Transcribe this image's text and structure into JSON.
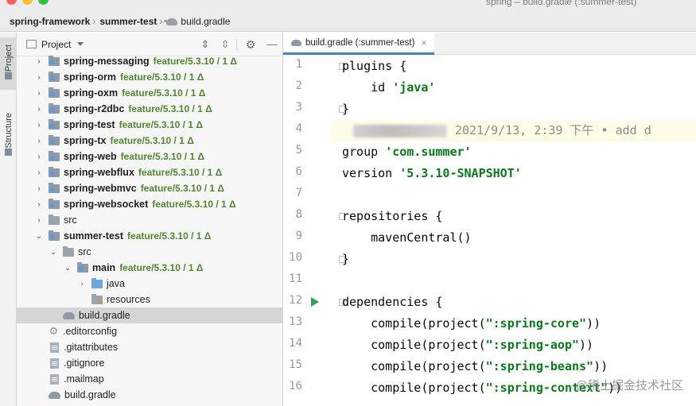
{
  "window": {
    "title": "spring – build.gradle (:summer-test)"
  },
  "breadcrumb": {
    "items": [
      "spring-framework",
      "summer-test",
      "build.gradle"
    ],
    "separator": "›"
  },
  "tool_strip": {
    "project_label": "Project",
    "structure_label": "Structure"
  },
  "project_panel": {
    "title": "Project",
    "buttons": {
      "expand": "⇕",
      "collapse": "⇳",
      "settings": "⚙",
      "minimize": "—"
    },
    "tree": [
      {
        "name": "spring-messaging",
        "branch": "feature/5.3.10 / 1 Δ",
        "bold": true,
        "icon": "module",
        "indent": 0,
        "arrow": "›"
      },
      {
        "name": "spring-orm",
        "branch": "feature/5.3.10 / 1 Δ",
        "bold": true,
        "icon": "module",
        "indent": 0,
        "arrow": "›"
      },
      {
        "name": "spring-oxm",
        "branch": "feature/5.3.10 / 1 Δ",
        "bold": true,
        "icon": "module",
        "indent": 0,
        "arrow": "›"
      },
      {
        "name": "spring-r2dbc",
        "branch": "feature/5.3.10 / 1 Δ",
        "bold": true,
        "icon": "module",
        "indent": 0,
        "arrow": "›"
      },
      {
        "name": "spring-test",
        "branch": "feature/5.3.10 / 1 Δ",
        "bold": true,
        "icon": "module",
        "indent": 0,
        "arrow": "›"
      },
      {
        "name": "spring-tx",
        "branch": "feature/5.3.10 / 1 Δ",
        "bold": true,
        "icon": "module",
        "indent": 0,
        "arrow": "›"
      },
      {
        "name": "spring-web",
        "branch": "feature/5.3.10 / 1 Δ",
        "bold": true,
        "icon": "module",
        "indent": 0,
        "arrow": "›"
      },
      {
        "name": "spring-webflux",
        "branch": "feature/5.3.10 / 1 Δ",
        "bold": true,
        "icon": "module",
        "indent": 0,
        "arrow": "›"
      },
      {
        "name": "spring-webmvc",
        "branch": "feature/5.3.10 / 1 Δ",
        "bold": true,
        "icon": "module",
        "indent": 0,
        "arrow": "›"
      },
      {
        "name": "spring-websocket",
        "branch": "feature/5.3.10 / 1 Δ",
        "bold": true,
        "icon": "module",
        "indent": 0,
        "arrow": "›"
      },
      {
        "name": "src",
        "branch": "",
        "bold": false,
        "icon": "folder",
        "indent": 0,
        "arrow": "›"
      },
      {
        "name": "summer-test",
        "branch": "feature/5.3.10 / 1 Δ",
        "bold": true,
        "icon": "module",
        "indent": 0,
        "arrow": "⌄"
      },
      {
        "name": "src",
        "branch": "",
        "bold": false,
        "icon": "folder",
        "indent": 1,
        "arrow": "⌄"
      },
      {
        "name": "main",
        "branch": "feature/5.3.10 / 1 Δ",
        "bold": true,
        "icon": "module",
        "indent": 2,
        "arrow": "⌄"
      },
      {
        "name": "java",
        "branch": "",
        "bold": false,
        "icon": "folder-blue",
        "indent": 3,
        "arrow": "›"
      },
      {
        "name": "resources",
        "branch": "",
        "bold": false,
        "icon": "folder-res",
        "indent": 3,
        "arrow": ""
      },
      {
        "name": "build.gradle",
        "branch": "",
        "bold": false,
        "icon": "gradle",
        "indent": 1,
        "arrow": "",
        "selected": true
      },
      {
        "name": ".editorconfig",
        "branch": "",
        "bold": false,
        "icon": "gear",
        "indent": 0,
        "arrow": ""
      },
      {
        "name": ".gitattributes",
        "branch": "",
        "bold": false,
        "icon": "file",
        "indent": 0,
        "arrow": ""
      },
      {
        "name": ".gitignore",
        "branch": "",
        "bold": false,
        "icon": "file",
        "indent": 0,
        "arrow": ""
      },
      {
        "name": ".mailmap",
        "branch": "",
        "bold": false,
        "icon": "file",
        "indent": 0,
        "arrow": ""
      },
      {
        "name": "build.gradle",
        "branch": "",
        "bold": false,
        "icon": "gradle",
        "indent": 0,
        "arrow": ""
      }
    ]
  },
  "editor": {
    "tab_label": "build.gradle (:summer-test)",
    "tab_close": "×",
    "line_numbers": [
      "1",
      "2",
      "3",
      "4",
      "5",
      "6",
      "7",
      "8",
      "9",
      "10",
      "11",
      "12",
      "13",
      "14",
      "15",
      "16"
    ],
    "lines": [
      [
        {
          "t": "plugins {",
          "c": "kw"
        }
      ],
      [
        {
          "t": "    id ",
          "c": "kw"
        },
        {
          "t": "'java'",
          "c": "str"
        }
      ],
      [
        {
          "t": "}",
          "c": "kw"
        }
      ],
      [
        {
          "t": "",
          "c": "blame"
        }
      ],
      [
        {
          "t": "group ",
          "c": "kw"
        },
        {
          "t": "'com.summer'",
          "c": "str"
        }
      ],
      [
        {
          "t": "version ",
          "c": "kw"
        },
        {
          "t": "'5.3.10-SNAPSHOT'",
          "c": "str"
        }
      ],
      [
        {
          "t": "",
          "c": "kw"
        }
      ],
      [
        {
          "t": "repositories {",
          "c": "kw"
        }
      ],
      [
        {
          "t": "    mavenCentral()",
          "c": "kw"
        }
      ],
      [
        {
          "t": "}",
          "c": "kw"
        }
      ],
      [
        {
          "t": "",
          "c": "kw"
        }
      ],
      [
        {
          "t": "dependencies {",
          "c": "kw"
        }
      ],
      [
        {
          "t": "    compile(project(",
          "c": "kw"
        },
        {
          "t": "\":spring-core\"",
          "c": "str"
        },
        {
          "t": "))",
          "c": "kw"
        }
      ],
      [
        {
          "t": "    compile(project(",
          "c": "kw"
        },
        {
          "t": "\":spring-aop\"",
          "c": "str"
        },
        {
          "t": "))",
          "c": "kw"
        }
      ],
      [
        {
          "t": "    compile(project(",
          "c": "kw"
        },
        {
          "t": "\":spring-beans\"",
          "c": "str"
        },
        {
          "t": "))",
          "c": "kw"
        }
      ],
      [
        {
          "t": "    compile(project(",
          "c": "kw"
        },
        {
          "t": "\":spring-context\"",
          "c": "str"
        },
        {
          "t": "))",
          "c": "kw"
        }
      ]
    ],
    "blame_annotation": "2021/9/13, 2:39 下午 • add d",
    "watermark": "@稀土掘金技术社区"
  }
}
